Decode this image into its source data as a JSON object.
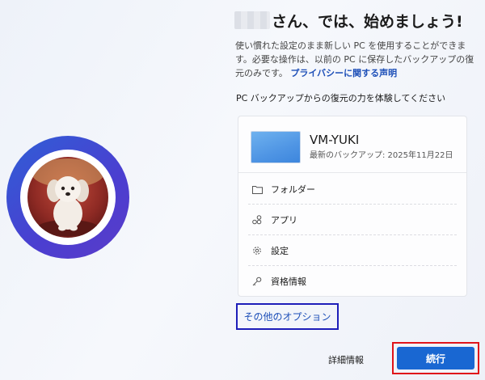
{
  "header": {
    "title_suffix": "さん、では、始めましょう!"
  },
  "description": {
    "text": "使い慣れた設定のまま新しい PC を使用することができます。必要な操作は、以前の PC に保存したバックアップの復元のみです。",
    "privacy_link": "プライバシーに関する声明"
  },
  "section_label": "PC バックアップからの復元の力を体験してください",
  "device": {
    "name": "VM-YUKI",
    "backup_label": "最新のバックアップ: 2025年11月22日"
  },
  "items": [
    {
      "label": "フォルダー",
      "icon": "folder-icon"
    },
    {
      "label": "アプリ",
      "icon": "apps-icon"
    },
    {
      "label": "設定",
      "icon": "gear-icon"
    },
    {
      "label": "資格情報",
      "icon": "key-icon"
    }
  ],
  "actions": {
    "more_options": "その他のオプション",
    "details": "詳細情報",
    "continue": "続行"
  },
  "colors": {
    "accent": "#1967d2",
    "link": "#1d4fb8",
    "highlight_blue": "#1e1eb9",
    "highlight_red": "#e0141a"
  }
}
